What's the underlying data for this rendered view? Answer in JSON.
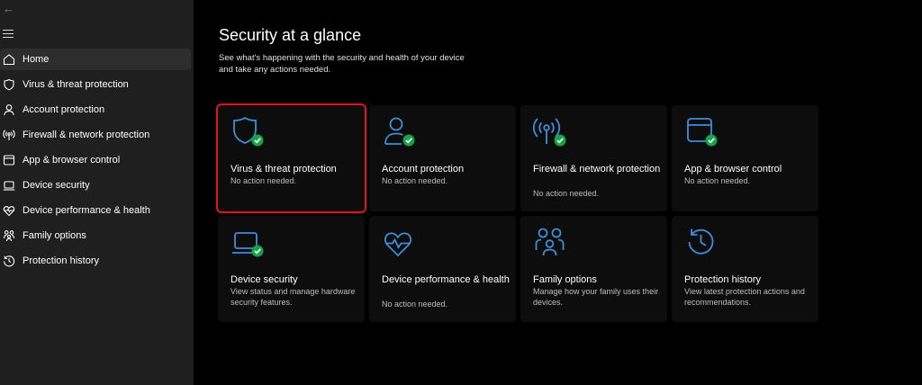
{
  "nav": {
    "back_icon": "back-arrow-icon",
    "menu_icon": "hamburger-menu-icon",
    "items": [
      {
        "label": "Home",
        "icon": "home-icon",
        "active": true
      },
      {
        "label": "Virus & threat protection",
        "icon": "shield-icon"
      },
      {
        "label": "Account protection",
        "icon": "person-icon"
      },
      {
        "label": "Firewall & network protection",
        "icon": "antenna-icon"
      },
      {
        "label": "App & browser control",
        "icon": "browser-window-icon"
      },
      {
        "label": "Device security",
        "icon": "laptop-icon"
      },
      {
        "label": "Device performance & health",
        "icon": "heart-pulse-icon"
      },
      {
        "label": "Family options",
        "icon": "family-icon"
      },
      {
        "label": "Protection history",
        "icon": "history-clock-icon"
      }
    ]
  },
  "main": {
    "title": "Security at a glance",
    "subtitle": "See what's happening with the security and health of your device and take any actions needed."
  },
  "cards": [
    {
      "title": "Virus & threat protection",
      "status": "No action needed.",
      "icon": "shield-check-icon",
      "selected": true
    },
    {
      "title": "Account protection",
      "status": "No action needed.",
      "icon": "person-check-icon"
    },
    {
      "title": "Firewall & network protection",
      "status": "No action needed.",
      "icon": "antenna-check-icon"
    },
    {
      "title": "App & browser control",
      "status": "No action needed.",
      "icon": "browser-check-icon"
    },
    {
      "title": "Device security",
      "status": "View status and manage hardware security features.",
      "icon": "laptop-check-icon"
    },
    {
      "title": "Device performance & health",
      "status": "No action needed.",
      "icon": "heart-pulse-icon"
    },
    {
      "title": "Family options",
      "status": "Manage how your family uses their devices.",
      "icon": "family-icon"
    },
    {
      "title": "Protection history",
      "status": "View latest protection actions and recommendations.",
      "icon": "history-clock-icon"
    }
  ],
  "colors": {
    "accent": "#0078d4",
    "success": "#16a34a",
    "selection": "#e81123",
    "sidebar_bg": "#1f1f1f",
    "card_bg": "#0d0d0d"
  }
}
